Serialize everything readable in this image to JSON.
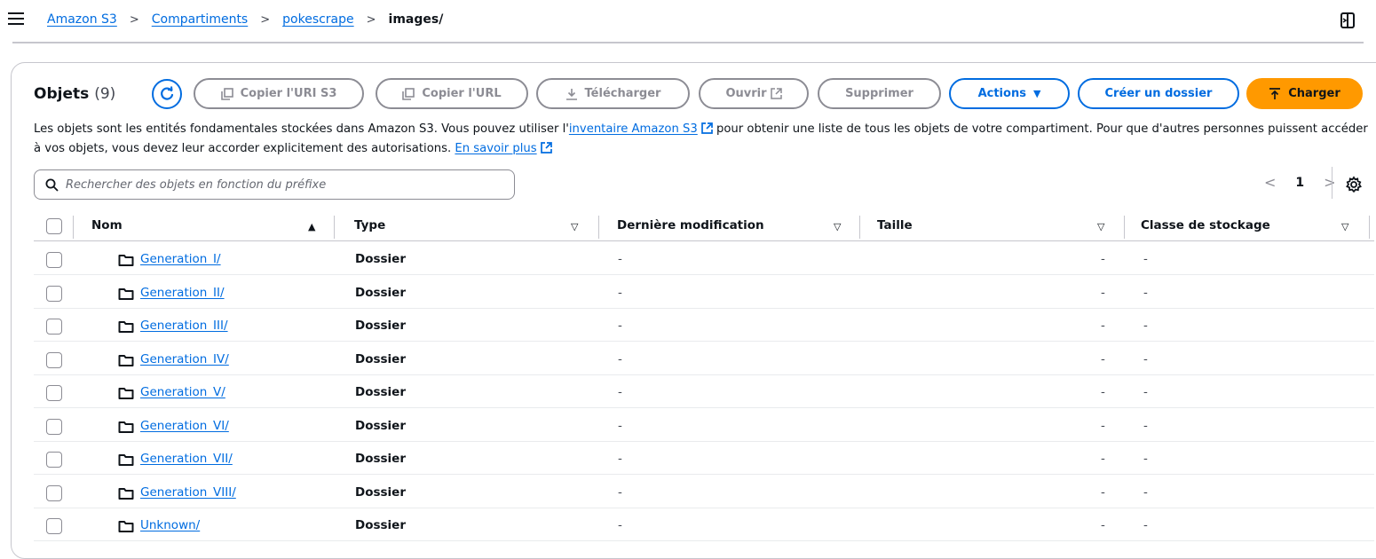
{
  "breadcrumb": {
    "items": [
      "Amazon S3",
      "Compartiments",
      "pokescrape"
    ],
    "current": "images/"
  },
  "objects": {
    "title": "Objets",
    "count": "(9)"
  },
  "toolbar": {
    "copy_uri": "Copier l'URI S3",
    "copy_url": "Copier l'URL",
    "download": "Télécharger",
    "open": "Ouvrir",
    "delete": "Supprimer",
    "actions": "Actions",
    "create_folder": "Créer un dossier",
    "upload": "Charger"
  },
  "description": {
    "part1": "Les objets sont les entités fondamentales stockées dans Amazon S3. Vous pouvez utiliser l'",
    "link1": "inventaire Amazon S3",
    "part2": " pour obtenir une liste de tous les objets de votre compartiment. Pour que d'autres personnes puissent accéder à vos objets, vous devez leur accorder explicitement des autorisations.",
    "link2": "En savoir plus"
  },
  "search": {
    "placeholder": "Rechercher des objets en fonction du préfixe"
  },
  "pagination": {
    "current_page": "1"
  },
  "table": {
    "headers": {
      "name": "Nom",
      "type": "Type",
      "modified": "Dernière modification",
      "size": "Taille",
      "storage": "Classe de stockage"
    },
    "rows": [
      {
        "name": "Generation_I/",
        "type": "Dossier",
        "modified": "-",
        "size": "-",
        "storage": "-"
      },
      {
        "name": "Generation_II/",
        "type": "Dossier",
        "modified": "-",
        "size": "-",
        "storage": "-"
      },
      {
        "name": "Generation_III/",
        "type": "Dossier",
        "modified": "-",
        "size": "-",
        "storage": "-"
      },
      {
        "name": "Generation_IV/",
        "type": "Dossier",
        "modified": "-",
        "size": "-",
        "storage": "-"
      },
      {
        "name": "Generation_V/",
        "type": "Dossier",
        "modified": "-",
        "size": "-",
        "storage": "-"
      },
      {
        "name": "Generation_VI/",
        "type": "Dossier",
        "modified": "-",
        "size": "-",
        "storage": "-"
      },
      {
        "name": "Generation_VII/",
        "type": "Dossier",
        "modified": "-",
        "size": "-",
        "storage": "-"
      },
      {
        "name": "Generation_VIII/",
        "type": "Dossier",
        "modified": "-",
        "size": "-",
        "storage": "-"
      },
      {
        "name": "Unknown/",
        "type": "Dossier",
        "modified": "-",
        "size": "-",
        "storage": "-"
      }
    ]
  },
  "icons": {
    "menu": "hamburger-icon",
    "split_panel": "split-panel-icon",
    "refresh": "refresh-icon",
    "copy": "copy-icon",
    "download": "download-icon",
    "external": "external-link-icon",
    "dropdown": "caret-down-icon",
    "upload": "upload-icon",
    "search": "search-icon",
    "settings": "gear-icon",
    "folder": "folder-icon"
  },
  "colors": {
    "link": "#006ce0",
    "upload_button": "#ff9900",
    "disabled": "#8c8c94"
  }
}
